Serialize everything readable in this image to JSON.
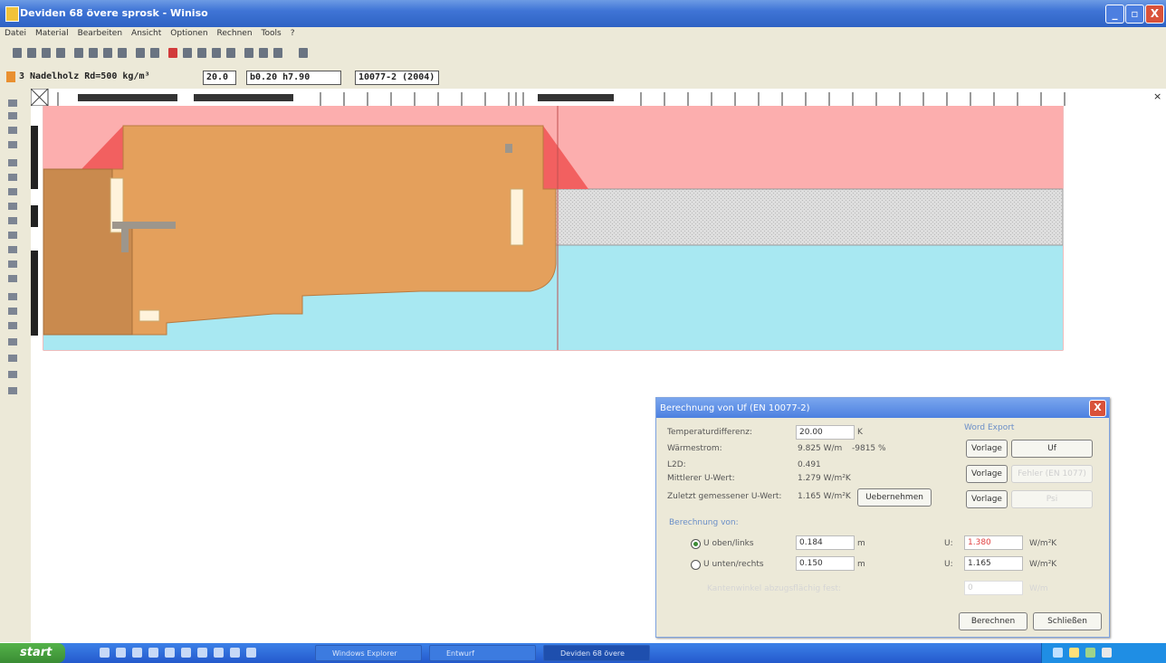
{
  "window": {
    "title": "Deviden 68 övere sprosk - Winiso",
    "controls": {
      "minimize": "_",
      "maximize": "▫",
      "close": "X"
    }
  },
  "menu": [
    "Datei",
    "Material",
    "Bearbeiten",
    "Ansicht",
    "Optionen",
    "Rechnen",
    "Tools",
    "?"
  ],
  "material_bar": {
    "material": "3 Nadelholz Rd=500 kg/m³",
    "thickness": "20.0",
    "dims": "b0.20  h7.90",
    "norm": "10077-2 (2004)"
  },
  "ruler": {
    "close_glyph": "×"
  },
  "scrollbar": {
    "v_arrow": "v"
  },
  "colors": {
    "wood": "#e4a05c",
    "wood_dark": "#c98a4e",
    "pink": "#fcaeae",
    "red": "#f26060",
    "cyan": "#a8e8f2",
    "cream": "#fff3dc",
    "steel": "#9d968c",
    "glass": "#d6d6d6"
  },
  "dialog": {
    "title": "Berechnung von Uf (EN 10077-2)",
    "temp_label": "Temperaturdifferenz:",
    "temp_value": "20.00",
    "temp_unit": "K",
    "heat_label": "Wärmestrom:",
    "heat_value": "9.825 W/m",
    "heat_pct": "-9815 %",
    "l2d_label": "L2D:",
    "l2d_value": "0.491",
    "mean_u_label": "Mittlerer U-Wert:",
    "mean_u_value": "1.279 W/m²K",
    "measured_label": "Zuletzt gemessener U-Wert:",
    "measured_value": "1.165 W/m²K",
    "accept_button": "Uebernehmen",
    "word_export_label": "Word Export",
    "vorlage_label": "Vorlage",
    "uf_button": "Uf",
    "wrong_button": "Fehler (EN 1077)",
    "psi_button": "Psi",
    "section_label": "Berechnung von:",
    "u_top_label": "U oben/links",
    "u_top_input": "0.184",
    "u_top_unit": "m",
    "u_top_prefix": "U:",
    "u_top_result": "1.380",
    "u_top_result_unit": "W/m²K",
    "u_bottom_label": "U unten/rechts",
    "u_bottom_input": "0.150",
    "u_bottom_unit": "m",
    "u_bottom_prefix": "U:",
    "u_bottom_result": "1.165",
    "u_bottom_result_unit": "W/m²K",
    "faded_label": "Kantenwinkel abzugsflächig fest:",
    "faded_value": "0",
    "faded_unit": "W/m",
    "calc_button": "Berechnen",
    "close_button": "Schließen"
  },
  "taskbar": {
    "start": "start",
    "tasks": [
      "Windows Explorer",
      "Entwurf",
      "Deviden 68 övere"
    ]
  }
}
